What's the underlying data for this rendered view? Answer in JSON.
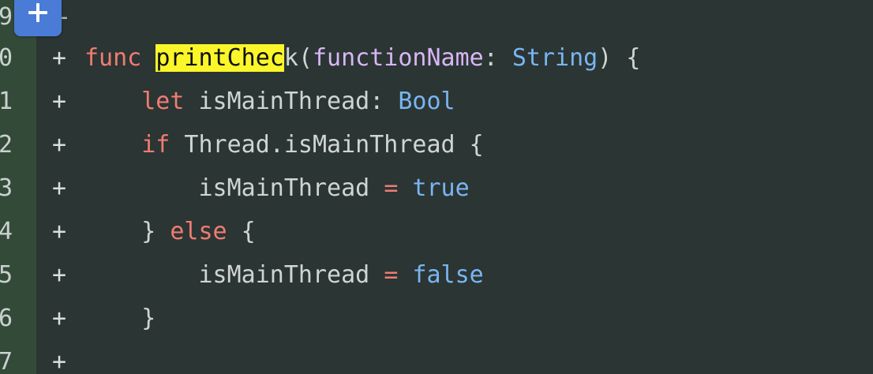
{
  "add_button": {
    "icon": "plus-icon",
    "color": "#4a7bd6"
  },
  "lines": [
    {
      "num": "9",
      "marker": "-",
      "code": ""
    },
    {
      "num": "0",
      "marker": "+",
      "code": "func printCheck(functionName: String) {"
    },
    {
      "num": "1",
      "marker": "+",
      "code": "    let isMainThread: Bool"
    },
    {
      "num": "2",
      "marker": "+",
      "code": "    if Thread.isMainThread {"
    },
    {
      "num": "3",
      "marker": "+",
      "code": "        isMainThread = true"
    },
    {
      "num": "4",
      "marker": "+",
      "code": "    } else {"
    },
    {
      "num": "5",
      "marker": "+",
      "code": "        isMainThread = false"
    },
    {
      "num": "6",
      "marker": "+",
      "code": "    }"
    },
    {
      "num": "7",
      "marker": "+",
      "code": ""
    }
  ],
  "tokens": {
    "l0": {
      "kw": "func",
      "sp": " ",
      "hl_pre": "printChec",
      "hl_post": "k",
      "open": "(",
      "param": "functionName",
      "colon": ": ",
      "type": "String",
      "close": ") {"
    },
    "l1": {
      "indent": "    ",
      "kw": "let",
      "rest": " isMainThread: ",
      "type": "Bool"
    },
    "l2": {
      "indent": "    ",
      "kw": "if",
      "rest": " Thread.isMainThread {"
    },
    "l3": {
      "indent": "        ",
      "name": "isMainThread ",
      "op": "=",
      "sp": " ",
      "lit": "true"
    },
    "l4": {
      "indent": "    ",
      "brace": "} ",
      "kw": "else",
      "rest": " {"
    },
    "l5": {
      "indent": "        ",
      "name": "isMainThread ",
      "op": "=",
      "sp": " ",
      "lit": "false"
    },
    "l6": {
      "indent": "    ",
      "brace": "}"
    }
  },
  "colors": {
    "background": "#2b3533",
    "gutter": "#344a39",
    "keyword": "#f07c73",
    "type": "#79b5f2",
    "parameter": "#d8b6f5",
    "highlight": "#faf62a"
  }
}
